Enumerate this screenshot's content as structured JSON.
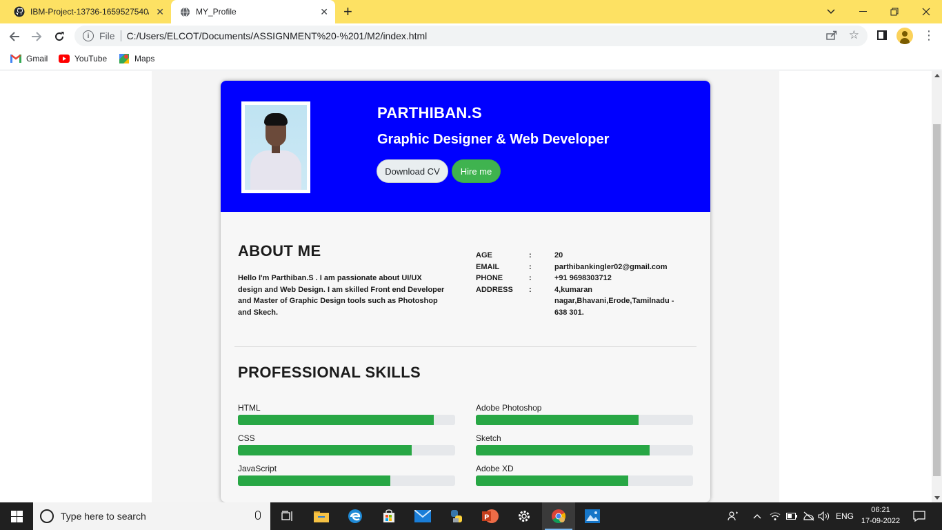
{
  "browser": {
    "tabs": [
      {
        "label": "IBM-Project-13736-1659527540/",
        "active": false,
        "icon": "github-icon"
      },
      {
        "label": "MY_Profile",
        "active": true,
        "icon": "globe-icon"
      }
    ],
    "omnibox": {
      "scheme_label": "File",
      "url": "C:/Users/ELCOT/Documents/ASSIGNMENT%20-%201/M2/index.html"
    },
    "bookmarks": [
      {
        "label": "Gmail",
        "icon": "gmail-icon"
      },
      {
        "label": "YouTube",
        "icon": "youtube-icon"
      },
      {
        "label": "Maps",
        "icon": "maps-icon"
      }
    ]
  },
  "profile": {
    "name": "PARTHIBAN.S",
    "role": "Graphic Designer & Web Developer",
    "download_cv_label": "Download CV",
    "hire_me_label": "Hire me"
  },
  "about": {
    "title": "ABOUT ME",
    "text": "Hello I'm Parthiban.S . I am passionate about UI/UX design and Web Design. I am skilled Front end Developer and Master of Graphic Design tools such as Photoshop and Skech.",
    "info": [
      {
        "key": "AGE",
        "colon": ":",
        "value": "20"
      },
      {
        "key": "EMAIL",
        "colon": ":",
        "value": "parthibankingler02@gmail.com"
      },
      {
        "key": "PHONE",
        "colon": ":",
        "value": "+91 9698303712"
      },
      {
        "key": "ADDRESS",
        "colon": ":",
        "value": "4,kumaran nagar,Bhavani,Erode,Tamilnadu - 638 301."
      }
    ]
  },
  "skills": {
    "title": "PROFESSIONAL SKILLS",
    "left": [
      {
        "label": "HTML",
        "level": 0.9
      },
      {
        "label": "CSS",
        "level": 0.8
      },
      {
        "label": "JavaScript",
        "level": 0.7
      }
    ],
    "right": [
      {
        "label": "Adobe Photoshop",
        "level": 0.75
      },
      {
        "label": "Sketch",
        "level": 0.8
      },
      {
        "label": "Adobe XD",
        "level": 0.7
      }
    ],
    "bar_color": "#28a745"
  },
  "taskbar": {
    "search_placeholder": "Type here to search",
    "language": "ENG",
    "time": "06:21",
    "date": "17-09-2022"
  },
  "colors": {
    "hero": "#0000ff",
    "tabbar": "#fde163",
    "hire_button": "#3fb34f"
  }
}
